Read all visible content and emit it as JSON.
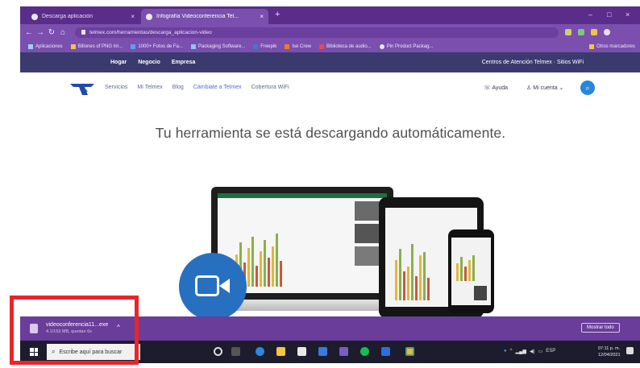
{
  "browser": {
    "tabs": [
      {
        "label": "Descarga aplicación"
      },
      {
        "label": "Infografía Videoconferencia Tel..."
      }
    ],
    "new_tab": "+",
    "window_controls": [
      "–",
      "□",
      "×"
    ],
    "nav": {
      "back": "←",
      "forward": "→",
      "reload": "↻",
      "home": "⌂"
    },
    "url": "telmex.com/herramientas/descarga_aplicacion-video",
    "bookmarks": [
      "Aplicaciones",
      "Billones of PNG Im...",
      "1000+ Fotos de Fa...",
      "Packaging Software...",
      "Freepik",
      "Ise Crew",
      "Biblioteca de audio...",
      "Pin Product Packag..."
    ],
    "reading_list": "Otros marcadores"
  },
  "site": {
    "topbar": {
      "links": [
        "Hogar",
        "Negocio",
        "Empresa"
      ],
      "right": "Centros de Atención Telmex · Sitios WiFi"
    },
    "nav": {
      "links": [
        "Servicios",
        "Mi Telmex",
        "Blog",
        "Cámbiate a Telmex",
        "Cobertura WiFi"
      ],
      "help": "Ayuda",
      "account": "Mi cuenta"
    },
    "headline": "Tu herramienta se está descargando automáticamente."
  },
  "download_shelf": {
    "file_name": "videoconferencia11...exe",
    "status": "4.1/153 MB, quedan 6s",
    "chevron": "^",
    "show_all": "Mostrar todo"
  },
  "taskbar": {
    "search_placeholder": "Escribe aquí para buscar",
    "time": "07:11 p. m.",
    "date": "12/04/2021",
    "lang": "ESP"
  },
  "colors": {
    "browser": "#6a3d9a",
    "highlight": "#e8262a",
    "accent": "#2670bf"
  }
}
